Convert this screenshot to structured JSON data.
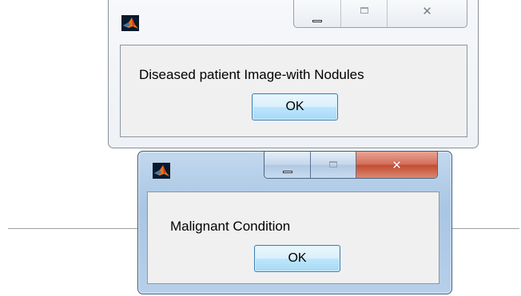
{
  "dialog1": {
    "message": "Diseased patient Image-with Nodules",
    "ok_label": "OK",
    "icon": "matlab-icon",
    "state": "inactive"
  },
  "dialog2": {
    "message": "Malignant Condition",
    "ok_label": "OK",
    "icon": "matlab-icon",
    "state": "active"
  },
  "colors": {
    "client_bg": "#f0f0f0",
    "active_frame": "#a9c6e4",
    "close_button": "#c34a31",
    "ok_button_border": "#3c7fb1"
  }
}
